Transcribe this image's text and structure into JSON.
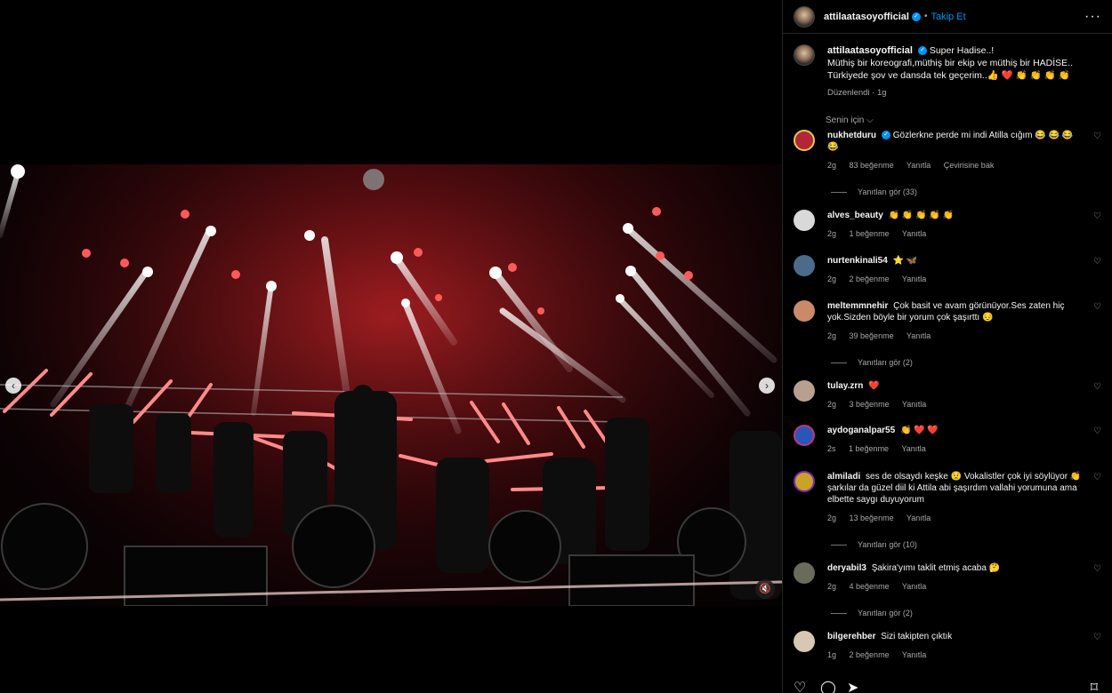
{
  "header": {
    "username": "attilaatasoyofficial",
    "separator": "•",
    "follow_label": "Takip Et",
    "more_icon": "more-icon"
  },
  "caption": {
    "username": "attilaatasoyofficial",
    "line1": "Super Hadise..!",
    "line2": "Müthiş bir koreografi,müthiş bir ekip ve müthiş bir HADİSE..",
    "line3": "Türkiyede şov ve dansda tek geçerim..👍 ❤️ 👏 👏 👏 👏",
    "meta": "Düzenlendi · 1g",
    "sort_label": "Senin için"
  },
  "comments": [
    {
      "username": "nukhetduru",
      "text": "Gözlerkne perde mi indi Atilla cığım 😂 😂 😂 😂",
      "time": "2g",
      "likes": "83 beğenme",
      "reply": "Yanıtla",
      "translate": "Çevirisine bak",
      "replies": "Yanıtları gör (33)",
      "color": "#b3263a"
    },
    {
      "username": "alves_beauty",
      "text": "👏 👏 👏 👏 👏",
      "time": "2g",
      "likes": "1 beğenme",
      "reply": "Yanıtla",
      "color": "#d9d9d9"
    },
    {
      "username": "nurtenkinali54",
      "text": "⭐ 🦋",
      "time": "2g",
      "likes": "2 beğenme",
      "reply": "Yanıtla",
      "color": "#4b6b8a"
    },
    {
      "username": "meltemmnehir",
      "text": "Çok basit ve avam görünüyor.Ses zaten hiç yok.Sizden böyle bir yorum çok şaşırttı 😔",
      "time": "2g",
      "likes": "39 beğenme",
      "reply": "Yanıtla",
      "replies": "Yanıtları gör (2)",
      "color": "#c98a6a"
    },
    {
      "username": "tulay.zrn",
      "text": "❤️",
      "time": "2g",
      "likes": "3 beğenme",
      "reply": "Yanıtla",
      "color": "#b8a090"
    },
    {
      "username": "aydoganalpar55",
      "text": "👏 ❤️ ❤️",
      "time": "2s",
      "likes": "1 beğenme",
      "reply": "Yanıtla",
      "color": "#2a57b5"
    },
    {
      "username": "almiladi",
      "text": "ses de olsaydı keşke 😟 Vokalistler çok iyi söylüyor 👏 şarkılar da güzel diil ki Attila abi şaşırdım vallahi yorumuna ama elbette saygı duyuyorum",
      "time": "2g",
      "likes": "13 beğenme",
      "reply": "Yanıtla",
      "replies": "Yanıtları gör (10)",
      "color": "#c9a227"
    },
    {
      "username": "deryabil3",
      "text": "Şakira'yımı taklit etmiş acaba 🤔",
      "time": "2g",
      "likes": "4 beğenme",
      "reply": "Yanıtla",
      "replies": "Yanıtları gör (2)",
      "color": "#6b6b5a"
    },
    {
      "username": "bilgerehber",
      "text": "Sizi takipten çıktık",
      "time": "1g",
      "likes": "2 beğenme",
      "reply": "Yanıtla",
      "color": "#d8c7b3"
    }
  ],
  "actions": {
    "like_icon": "heart-icon",
    "comment_icon": "comment-icon",
    "share_icon": "share-icon",
    "save_icon": "bookmark-icon"
  },
  "media": {
    "prev_icon": "chevron-left-icon",
    "next_icon": "chevron-right-icon",
    "mute_icon": "muted-speaker-icon"
  }
}
